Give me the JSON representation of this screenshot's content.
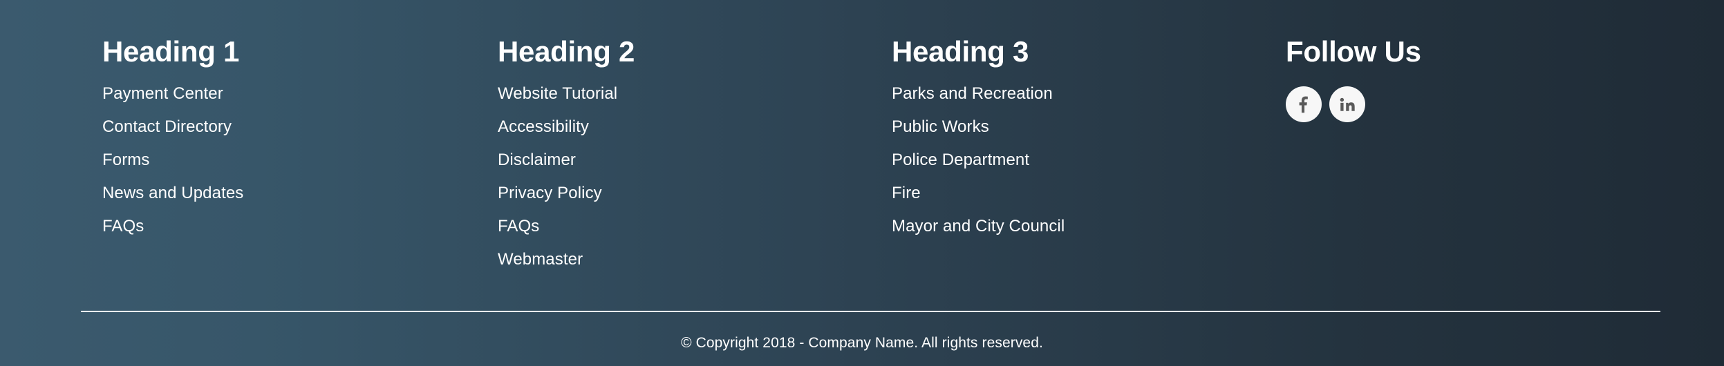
{
  "background": {
    "gradient_start": "#3b5a6e",
    "gradient_end": "#1f2b36"
  },
  "columns": [
    {
      "heading": "Heading 1",
      "links": [
        "Payment Center",
        "Contact Directory",
        "Forms",
        "News and Updates",
        "FAQs"
      ]
    },
    {
      "heading": "Heading 2",
      "links": [
        "Website Tutorial",
        "Accessibility",
        "Disclaimer",
        "Privacy Policy",
        "FAQs",
        "Webmaster"
      ]
    },
    {
      "heading": "Heading 3",
      "links": [
        "Parks and Recreation",
        "Public Works",
        "Police Department",
        "Fire",
        "Mayor and City Council"
      ]
    }
  ],
  "social": {
    "heading": "Follow Us",
    "icon_color": "#5a5a5a",
    "circle_color": "#f7f7f7",
    "items": [
      {
        "name": "facebook-icon",
        "label": "Facebook"
      },
      {
        "name": "linkedin-icon",
        "label": "LinkedIn"
      }
    ]
  },
  "copyright": "© Copyright 2018 - Company Name. All rights reserved."
}
